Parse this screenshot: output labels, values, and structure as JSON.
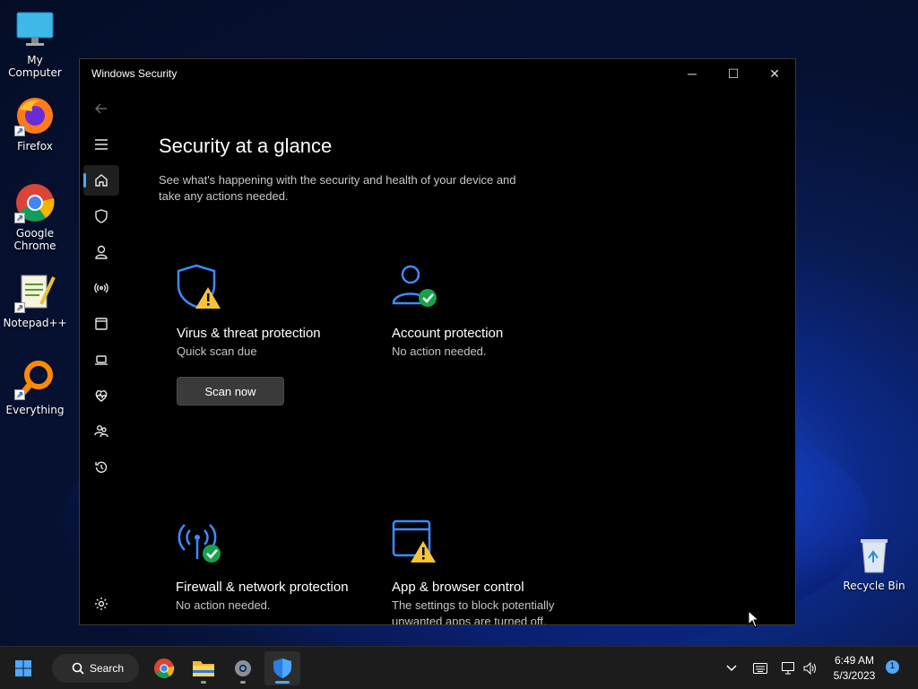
{
  "desktop": {
    "icons": [
      {
        "label": "My Computer",
        "icon": "monitor-icon"
      },
      {
        "label": "Firefox",
        "icon": "firefox-icon"
      },
      {
        "label": "Google Chrome",
        "icon": "chrome-icon"
      },
      {
        "label": "Notepad++",
        "icon": "notepad-icon"
      },
      {
        "label": "Everything",
        "icon": "magnifier-icon"
      },
      {
        "label": "Recycle Bin",
        "icon": "recycle-bin-icon"
      }
    ]
  },
  "window": {
    "title": "Windows Security",
    "minimize_glyph": "─",
    "maximize_glyph": "☐",
    "close_glyph": "✕"
  },
  "page": {
    "title": "Security at a glance",
    "subtitle": "See what's happening with the security and health of your device and take any actions needed."
  },
  "cards": [
    {
      "title": "Virus & threat protection",
      "status": "Quick scan due",
      "button": "Scan now",
      "icon": "shield-warning-icon"
    },
    {
      "title": "Account protection",
      "status": "No action needed.",
      "icon": "account-ok-icon"
    },
    {
      "title": "Firewall & network protection",
      "status": "No action needed.",
      "icon": "firewall-ok-icon"
    },
    {
      "title": "App & browser control",
      "status": "The settings to block potentially unwanted apps are turned off.",
      "icon": "browser-warning-icon"
    }
  ],
  "taskbar": {
    "search_label": "Search",
    "time": "6:49 AM",
    "date": "5/3/2023",
    "notification_count": "1"
  },
  "colors": {
    "accent": "#4ea8ff",
    "warning": "#f7c33a",
    "ok": "#16a34a",
    "icon_blue": "#3d8bff"
  }
}
